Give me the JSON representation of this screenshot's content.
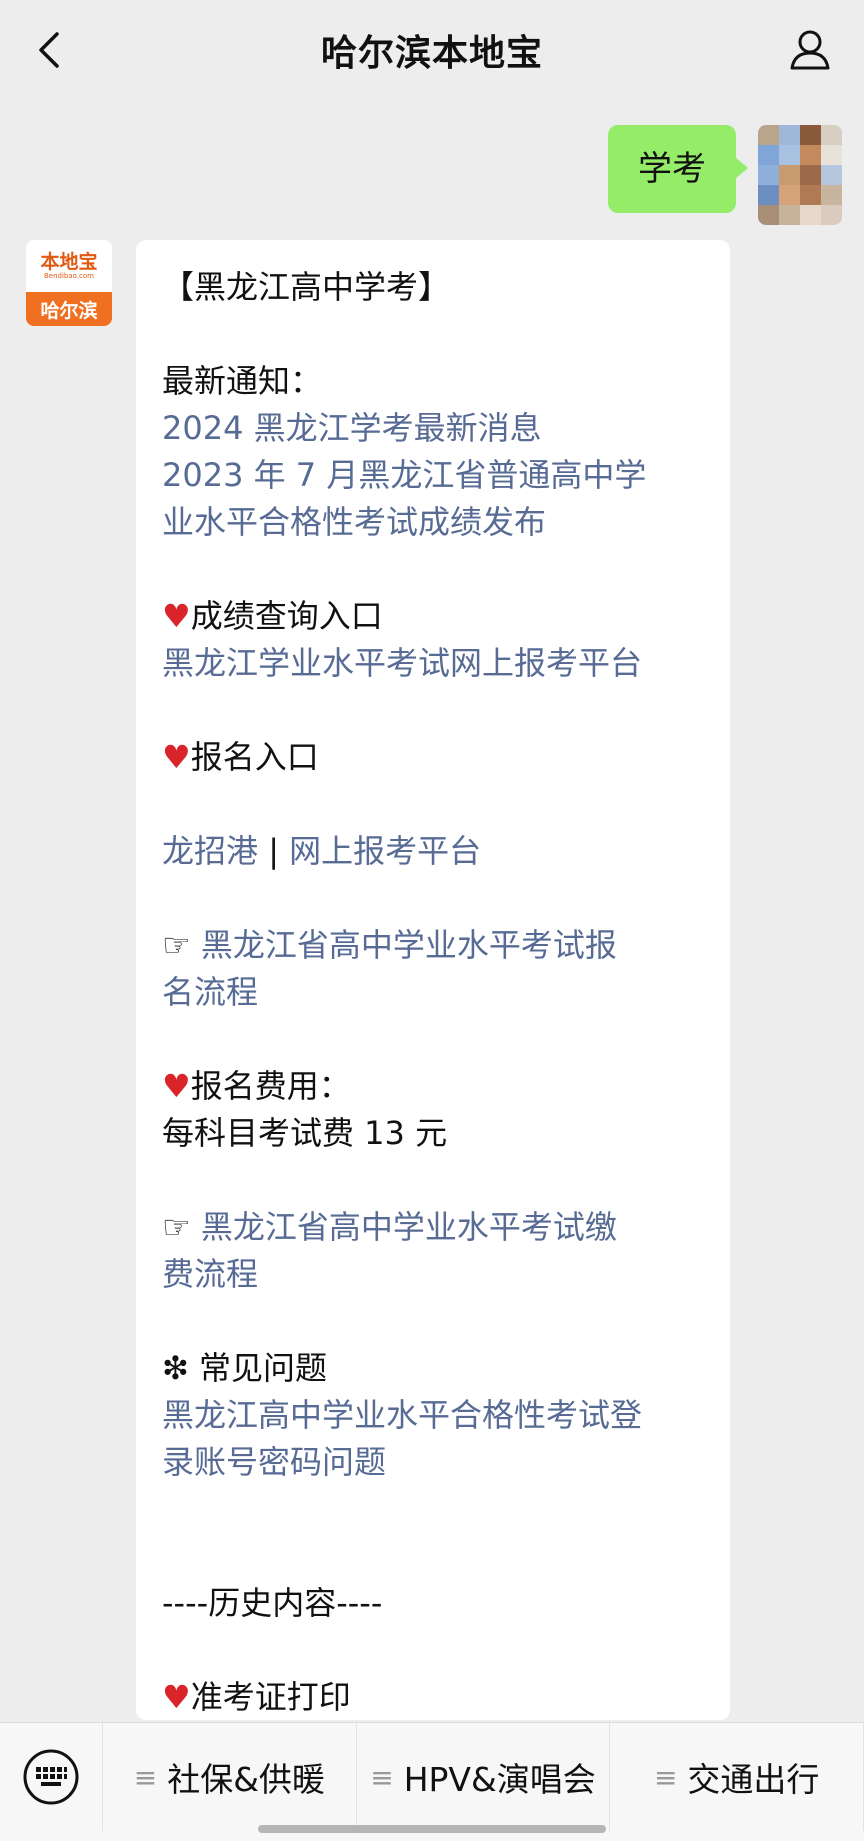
{
  "header": {
    "title": "哈尔滨本地宝",
    "back_icon": "chevron-left-icon",
    "profile_icon": "person-icon"
  },
  "outgoing": {
    "text": "学考",
    "bubble_color": "#95ec69"
  },
  "bot_avatar": {
    "logo_text": "本地宝",
    "logo_sub": "Bendibao.com",
    "city": "哈尔滨",
    "brand_color": "#f07021"
  },
  "message": {
    "title": "【黑龙江高中学考】",
    "notice_heading": "最新通知：",
    "notice_link_1": "2024 黑龙江学考最新消息",
    "notice_link_2_line1": "2023 年 7 月黑龙江省普通高中学",
    "notice_link_2_line2": "业水平合格性考试成绩发布",
    "score_heading": "成绩查询入口",
    "score_link": "黑龙江学业水平考试网上报考平台",
    "register_heading": "报名入口",
    "register_link_a": "龙招港",
    "register_sep": " | ",
    "register_link_b": "网上报考平台",
    "process_pointer": "☞",
    "process_link_line1": "黑龙江省高中学业水平考试报",
    "process_link_line2": "名流程",
    "fee_heading": "报名费用：",
    "fee_text": "每科目考试费 13 元",
    "pay_pointer": "☞",
    "pay_link_line1": "黑龙江省高中学业水平考试缴",
    "pay_link_line2": "费流程",
    "faq_bullet": "❇",
    "faq_heading": "常见问题",
    "faq_link_line1": "黑龙江高中学业水平合格性考试登",
    "faq_link_line2": "录账号密码问题",
    "history_divider": "----历史内容----",
    "admission_heading": "准考证打印",
    "heart_icon": "heart-icon",
    "link_color": "#576b95"
  },
  "menubar": {
    "keyboard_icon": "keyboard-icon",
    "items": [
      {
        "label": "社保&供暖"
      },
      {
        "label": "HPV&演唱会"
      },
      {
        "label": "交通出行"
      }
    ]
  }
}
